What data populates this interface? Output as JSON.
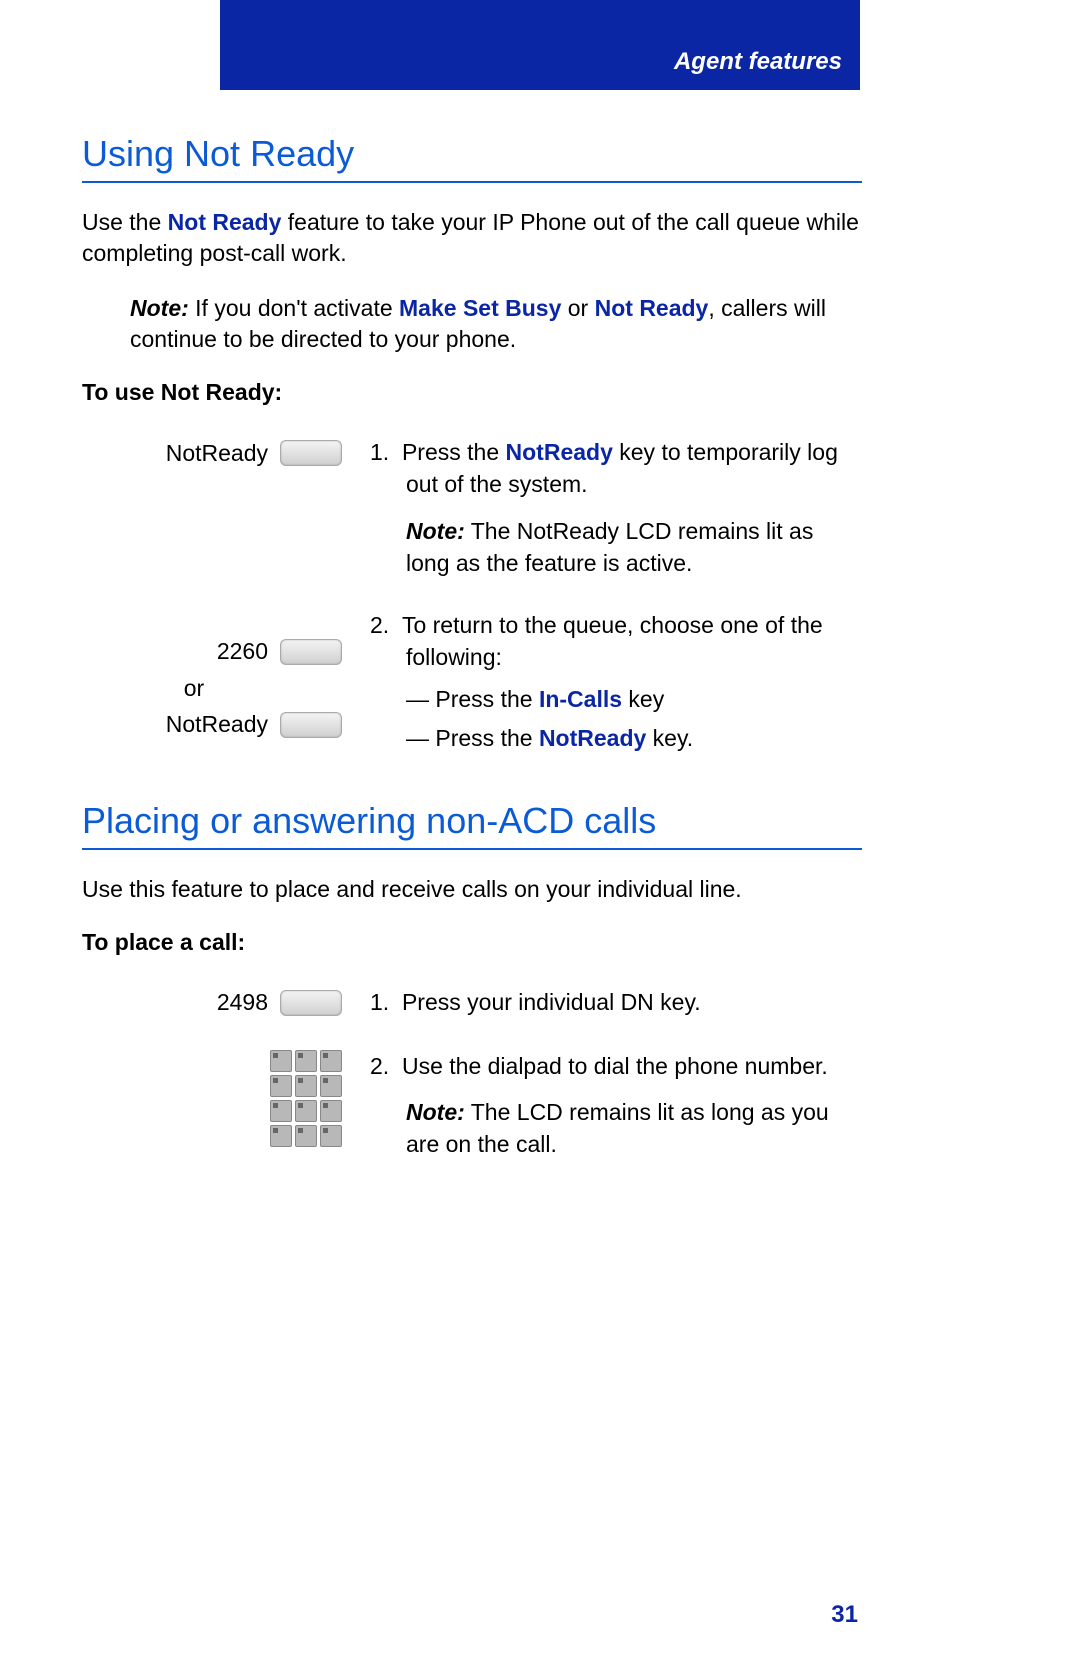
{
  "header": {
    "title": "Agent features"
  },
  "section1": {
    "title": "Using Not Ready",
    "intro_pre": "Use the ",
    "intro_link": "Not Ready",
    "intro_post": " feature to take your IP Phone out of the call queue while completing post-call work.",
    "note_label": "Note:",
    "note_pre": " If you don't activate ",
    "note_link1": "Make Set Busy",
    "note_mid": " or ",
    "note_link2": "Not Ready",
    "note_post": ", callers will continue to be directed to your phone.",
    "sub_heading": "To use Not Ready:",
    "key1_label": "NotReady",
    "step1_num": "1.",
    "step1_pre": "Press the ",
    "step1_link": "NotReady",
    "step1_post": " key to temporarily log out of the system.",
    "step1_note_label": "Note:",
    "step1_note": " The NotReady LCD remains lit as long as the feature is active.",
    "key2_label": "2260",
    "key_or": "or",
    "key3_label": "NotReady",
    "step2_num": "2.",
    "step2_text": "To return to the queue, choose one of the following:",
    "dash1_pre": "— Press the ",
    "dash1_link": "In-Calls",
    "dash1_post": " key",
    "dash2_pre": "— Press the ",
    "dash2_link": "NotReady",
    "dash2_post": " key."
  },
  "section2": {
    "title": "Placing or answering non-ACD calls",
    "intro": "Use this feature to place and receive calls on your individual line.",
    "sub_heading": "To place a call:",
    "key1_label": "2498",
    "step1_num": "1.",
    "step1_text": "Press your individual DN key.",
    "step2_num": "2.",
    "step2_text": "Use the dialpad to dial the phone number.",
    "step2_note_label": "Note:",
    "step2_note": " The LCD remains lit as long as you are on the call."
  },
  "page_number": "31"
}
